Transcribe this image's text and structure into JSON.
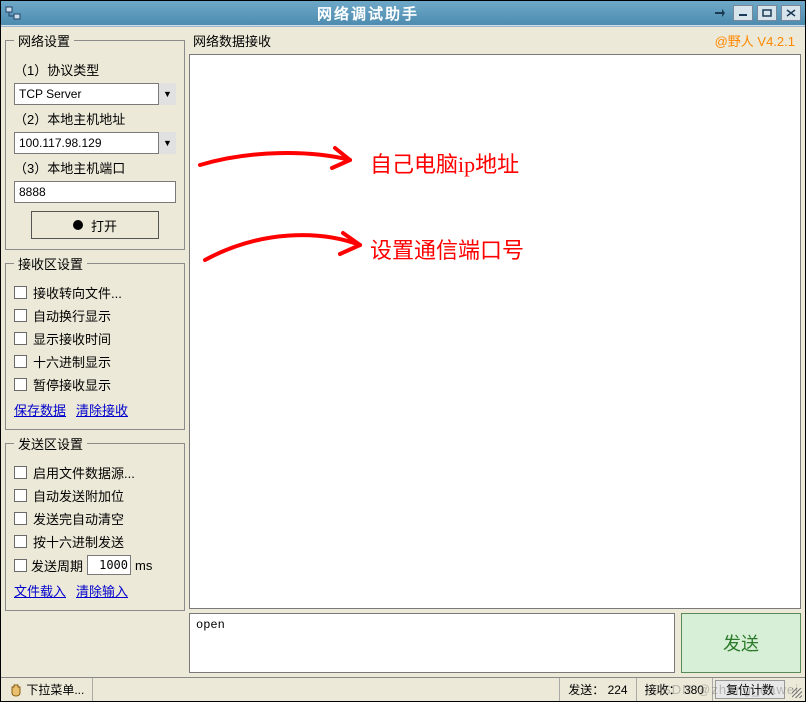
{
  "window": {
    "title": "网络调试助手"
  },
  "brand": {
    "text": "@野人  V4.2.1"
  },
  "panels": {
    "network": {
      "legend": "网络设置",
      "protocol_label": "（1）协议类型",
      "protocol_value": "TCP Server",
      "host_label": "（2）本地主机地址",
      "host_value": "100.117.98.129",
      "port_label": "（3）本地主机端口",
      "port_value": "8888",
      "open_label": "打开"
    },
    "recv_opts": {
      "legend": "接收区设置",
      "items": [
        "接收转向文件...",
        "自动换行显示",
        "显示接收时间",
        "十六进制显示",
        "暂停接收显示"
      ],
      "link_save": "保存数据",
      "link_clear": "清除接收"
    },
    "send_opts": {
      "legend": "发送区设置",
      "items": [
        "启用文件数据源...",
        "自动发送附加位",
        "发送完自动清空",
        "按十六进制发送"
      ],
      "period_label": "发送周期",
      "period_value": "1000",
      "period_unit": "ms",
      "link_load": "文件载入",
      "link_clear": "清除输入"
    }
  },
  "recv": {
    "title": "网络数据接收"
  },
  "send": {
    "value": "open",
    "button": "发送"
  },
  "status": {
    "menu": "下拉菜单...",
    "tx_label": "发送：",
    "tx_value": "224",
    "rx_label": "接收：",
    "rx_value": "380",
    "reset": "复位计数"
  },
  "annotations": {
    "ip": "自己电脑ip地址",
    "port": "设置通信端口号"
  },
  "watermark": "CSDN @zhang_dawei"
}
